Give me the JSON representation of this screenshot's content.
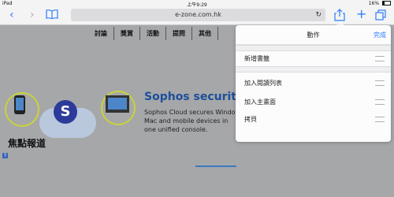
{
  "status": {
    "device": "iPad",
    "time": "上午9:29",
    "battery": "16%"
  },
  "browser": {
    "url": "e-zone.com.hk"
  },
  "web": {
    "nav": [
      "討論",
      "獎賞",
      "活動",
      "提問",
      "其他"
    ],
    "ad_title": "Sophos security. Cl",
    "ad_body": [
      "Sophos Cloud secures Window",
      "Mac and mobile devices in",
      "one unified console."
    ],
    "section_title": "焦點報道",
    "help_icon": "?"
  },
  "sheet": {
    "title": "動作",
    "done": "完成",
    "items": [
      "新增書籤",
      "加入閱讀列表",
      "加入主畫面",
      "拷貝"
    ]
  }
}
